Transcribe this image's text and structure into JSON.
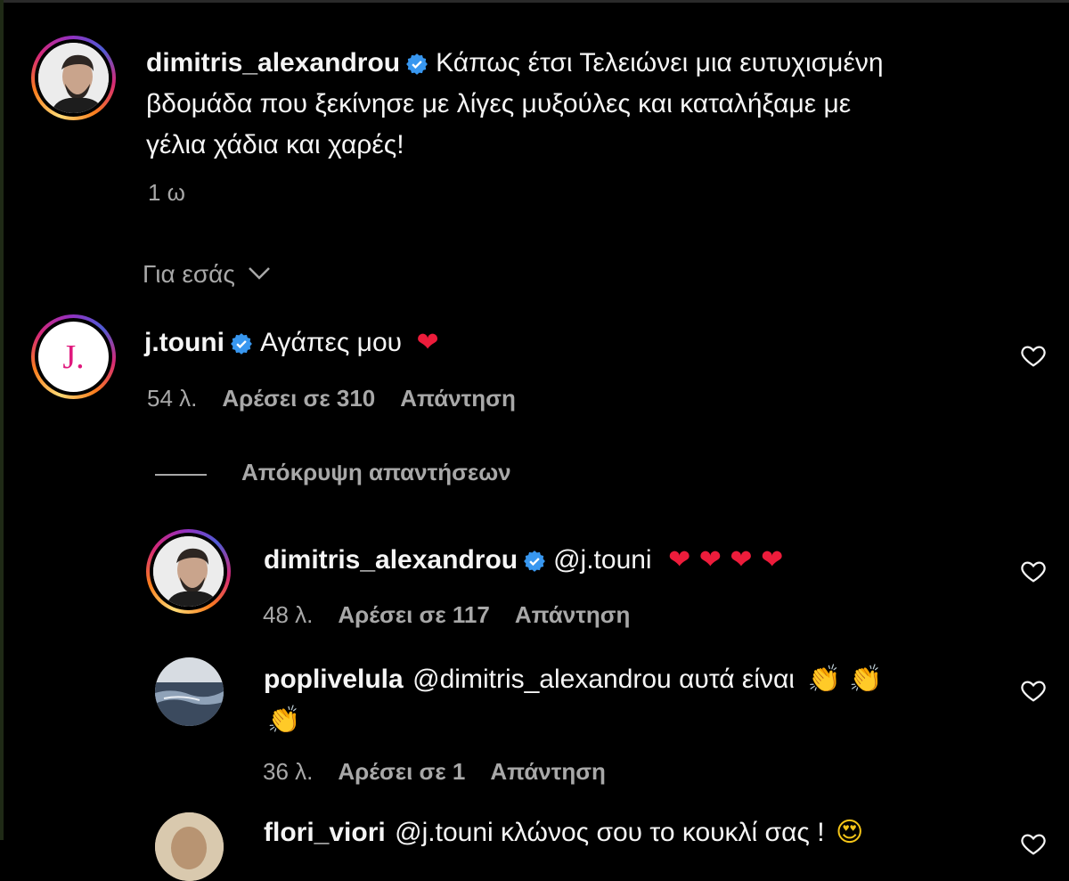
{
  "post": {
    "username": "dimitris_alexandrou",
    "caption_line1": "Κάπως έτσι Τελειώνει μια ευτυχισμένη",
    "caption_line2": "βδομάδα που ξεκίνησε με λίγες μυξούλες και καταλήξαμε με",
    "caption_line3": "γέλια χάδια και χαρές!",
    "time": "1 ω"
  },
  "filter": {
    "label": "Για εσάς"
  },
  "comments": [
    {
      "username": "j.touni",
      "text": "Αγάπες μου",
      "emoji": "❤",
      "time": "54 λ.",
      "likes": "Αρέσει σε 310",
      "reply": "Απάντηση",
      "avatar_letter": "J."
    }
  ],
  "hide_replies": "Απόκρυψη απαντήσεων",
  "replies": [
    {
      "username": "dimitris_alexandrou",
      "text": "@j.touni",
      "emoji": "❤ ❤ ❤ ❤",
      "time": "48 λ.",
      "likes": "Αρέσει σε 117",
      "reply": "Απάντηση"
    },
    {
      "username": "poplivelula",
      "text": "@dimitris_alexandrou αυτά είναι",
      "emoji_line1": "👏 👏",
      "emoji_line2": "👏",
      "time": "36 λ.",
      "likes": "Αρέσει σε 1",
      "reply": "Απάντηση"
    },
    {
      "username": "flori_viori",
      "text": "@j.touni κλώνος σου το κουκλί σας !",
      "emoji": "😍"
    }
  ],
  "colors": {
    "background": "#000000",
    "text": "#f5f5f5",
    "muted": "#a8a8a8",
    "verified": "#3897f0",
    "heart": "#ed1c3b"
  }
}
